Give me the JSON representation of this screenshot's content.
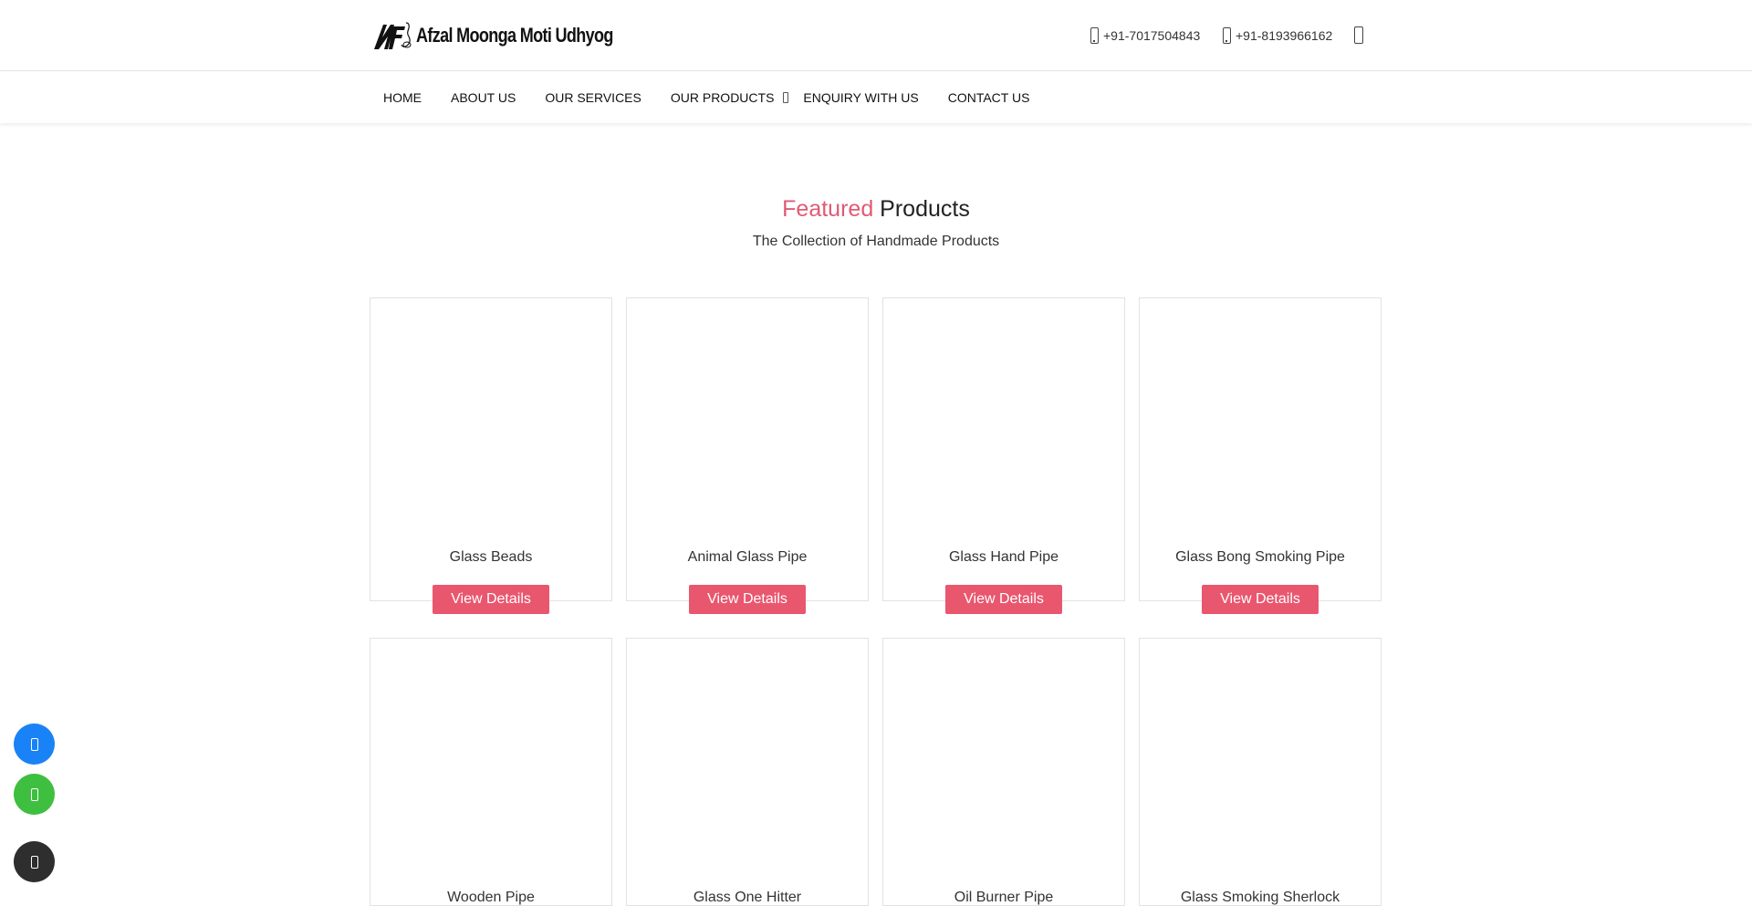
{
  "header": {
    "logo_text": "Afzal Moonga Moti Udhyog",
    "phone_1": "+91-7017504843",
    "phone_2": "+91-8193966162",
    "icons": [
      "phone-icon",
      "phone-icon",
      "mail-icon"
    ]
  },
  "nav": {
    "items": [
      {
        "label": "HOME"
      },
      {
        "label": "ABOUT US"
      },
      {
        "label": "OUR SERVICES"
      },
      {
        "label": "OUR PRODUCTS"
      },
      {
        "label": "ENQUIRY WITH US"
      },
      {
        "label": "CONTACT US"
      }
    ]
  },
  "featured": {
    "title_accent": "Featured",
    "title_rest": "Products",
    "subtitle": "The Collection of Handmade Products",
    "button_label": "View Details",
    "products": [
      {
        "name": "Glass Beads"
      },
      {
        "name": "Animal Glass Pipe"
      },
      {
        "name": "Glass Hand Pipe"
      },
      {
        "name": "Glass Bong Smoking Pipe"
      },
      {
        "name": "Wooden Pipe"
      },
      {
        "name": "Glass One Hitter"
      },
      {
        "name": "Oil Burner Pipe"
      },
      {
        "name": "Glass Smoking Sherlock"
      }
    ]
  },
  "floating": {
    "icons": [
      "phone-icon",
      "whatsapp-icon",
      "arrow-up-icon"
    ]
  },
  "colors": {
    "accent": "#e05a73",
    "button": "#e9576f",
    "call_button": "#1a82f7",
    "whatsapp_button": "#3fbf3f",
    "scroll_top_button": "#2e2e2e"
  }
}
